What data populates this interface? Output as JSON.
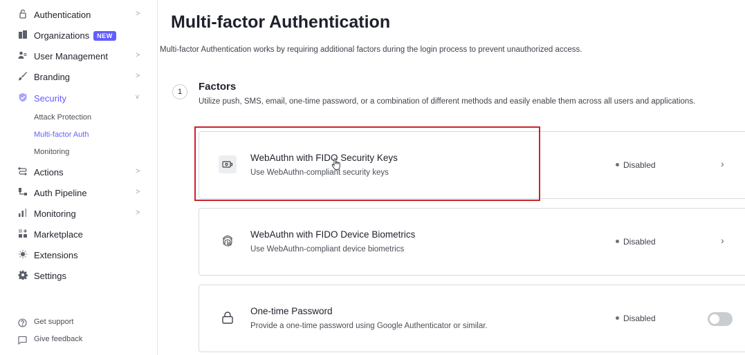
{
  "sidebar": {
    "items": [
      {
        "label": "Authentication",
        "icon": "lock-icon",
        "chevron": ">"
      },
      {
        "label": "Organizations",
        "icon": "building-icon",
        "badge": "NEW"
      },
      {
        "label": "User Management",
        "icon": "users-icon",
        "chevron": ">"
      },
      {
        "label": "Branding",
        "icon": "brush-icon",
        "chevron": ">"
      },
      {
        "label": "Security",
        "icon": "shield-check-icon",
        "chevron": "v"
      },
      {
        "label": "Actions",
        "icon": "actions-icon",
        "chevron": ">"
      },
      {
        "label": "Auth Pipeline",
        "icon": "pipeline-icon",
        "chevron": ">"
      },
      {
        "label": "Monitoring",
        "icon": "bar-chart-icon",
        "chevron": ">"
      },
      {
        "label": "Marketplace",
        "icon": "marketplace-icon"
      },
      {
        "label": "Extensions",
        "icon": "extensions-icon"
      },
      {
        "label": "Settings",
        "icon": "gear-icon"
      }
    ],
    "security_sub": [
      {
        "label": "Attack Protection"
      },
      {
        "label": "Multi-factor Auth"
      },
      {
        "label": "Monitoring"
      }
    ],
    "footer": [
      {
        "label": "Get support",
        "icon": "help-circle-icon"
      },
      {
        "label": "Give feedback",
        "icon": "feedback-icon"
      }
    ]
  },
  "main": {
    "title": "Multi-factor Authentication",
    "description": "Multi-factor Authentication works by requiring additional factors during the login process to prevent unauthorized access.",
    "section": {
      "step": "1",
      "title": "Factors",
      "description": "Utilize push, SMS, email, one-time password, or a combination of different methods and easily enable them across all users and applications."
    },
    "factors": [
      {
        "title": "WebAuthn with FIDO Security Keys",
        "description": "Use WebAuthn-compliant security keys",
        "status": "Disabled",
        "icon": "security-key-icon"
      },
      {
        "title": "WebAuthn with FIDO Device Biometrics",
        "description": "Use WebAuthn-compliant device biometrics",
        "status": "Disabled",
        "icon": "fingerprint-icon"
      },
      {
        "title": "One-time Password",
        "description": "Provide a one-time password using Google Authenticator or similar.",
        "status": "Disabled",
        "icon": "padlock-icon",
        "toggle_on": false
      }
    ]
  },
  "colors": {
    "accent": "#635dff",
    "highlight": "#c8242b",
    "border": "#d6d9dd"
  }
}
